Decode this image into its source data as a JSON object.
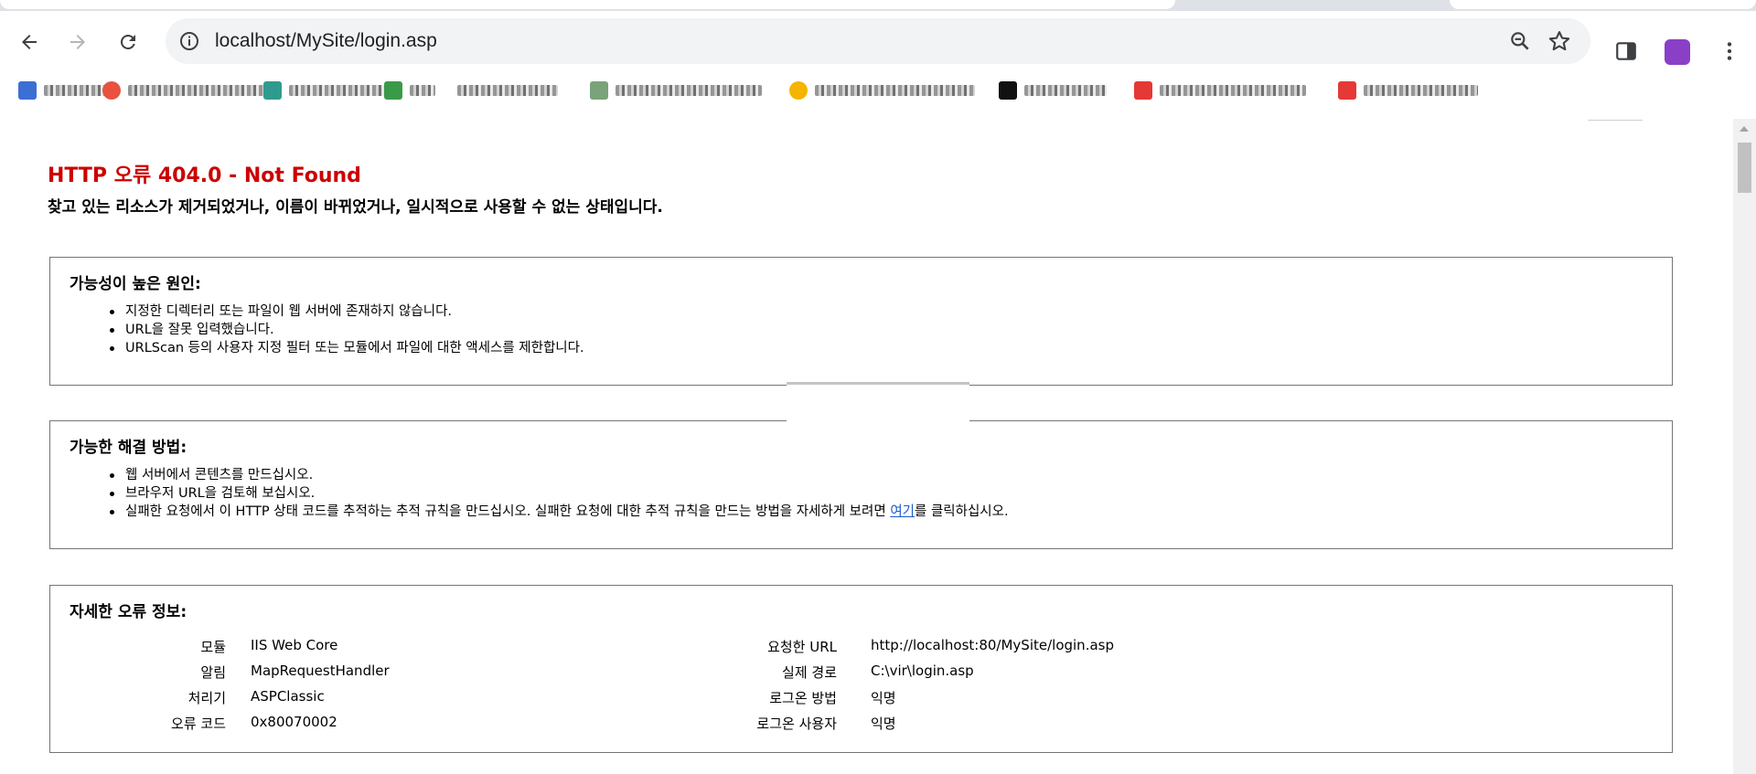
{
  "browser": {
    "url": "localhost/MySite/login.asp",
    "bookmarks": [
      {
        "fav_color": "#3b6fd4",
        "blur_w": 70
      },
      {
        "fav_color": "#e8523f",
        "blur_w": 150
      },
      {
        "fav_color": "#2f9b8f",
        "blur_w": 110
      },
      {
        "fav_color": "#3a9a4a",
        "blur_w": 28
      },
      {
        "fav_color": "#ffffff",
        "blur_w": 110
      },
      {
        "fav_color": "#7aa37a",
        "blur_w": 160
      },
      {
        "fav_color": "#f4b400",
        "blur_w": 175
      },
      {
        "fav_color": "#111111",
        "blur_w": 90
      },
      {
        "fav_color": "#e53935",
        "blur_w": 160
      },
      {
        "fav_color": "#e53935",
        "blur_w": 125
      }
    ],
    "icons": {
      "back": "arrow-left-icon",
      "forward": "arrow-right-icon",
      "reload": "reload-icon",
      "info": "info-icon",
      "zoom": "zoom-icon",
      "star": "star-icon",
      "side_panel": "side-panel-icon",
      "menu": "more-vert-icon"
    },
    "profile_color": "#8a3fc7"
  },
  "page": {
    "title": "HTTP 오류 404.0 - Not Found",
    "subtitle": "찾고 있는 리소스가 제거되었거나, 이름이 바뀌었거나, 일시적으로 사용할 수 없는 상태입니다.",
    "causes": {
      "heading": "가능성이 높은 원인:",
      "items": [
        "지정한 디렉터리 또는 파일이 웹 서버에 존재하지 않습니다.",
        "URL을 잘못 입력했습니다.",
        "URLScan 등의 사용자 지정 필터 또는 모듈에서 파일에 대한 액세스를 제한합니다."
      ]
    },
    "solutions": {
      "heading": "가능한 해결 방법:",
      "items": [
        "웹 서버에서 콘텐츠를 만드십시오.",
        "브라우저 URL을 검토해 보십시오."
      ],
      "last_prefix": "실패한 요청에서 이 HTTP 상태 코드를 추적하는 추적 규칙을 만드십시오. 실패한 요청에 대한 추적 규칙을 만드는 방법을 자세하게 보려면 ",
      "last_link": "여기",
      "last_suffix": "를 클릭하십시오."
    },
    "details": {
      "heading": "자세한 오류 정보:",
      "left": [
        {
          "label": "모듈",
          "value": "IIS Web Core"
        },
        {
          "label": "알림",
          "value": "MapRequestHandler"
        },
        {
          "label": "처리기",
          "value": "ASPClassic"
        },
        {
          "label": "오류 코드",
          "value": "0x80070002"
        }
      ],
      "right": [
        {
          "label": "요청한 URL",
          "value": "http://localhost:80/MySite/login.asp"
        },
        {
          "label": "실제 경로",
          "value": "C:\\vir\\login.asp"
        },
        {
          "label": "로그온 방법",
          "value": "익명"
        },
        {
          "label": "로그온 사용자",
          "value": "익명"
        }
      ]
    }
  }
}
